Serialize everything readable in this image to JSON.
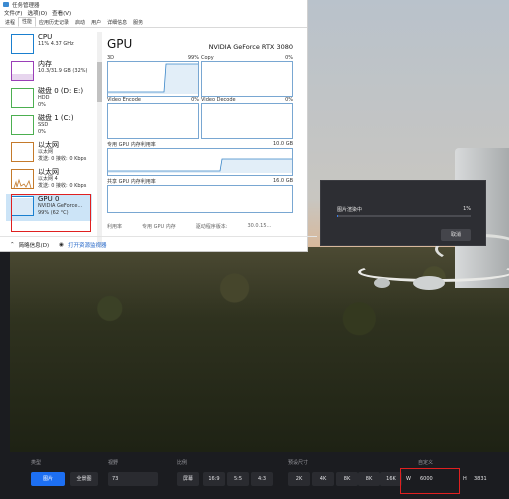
{
  "task_manager": {
    "title": "任务管理器",
    "menu": [
      "文件(F)",
      "选项(O)",
      "查看(V)"
    ],
    "tabs": [
      "进程",
      "性能",
      "应用历史记录",
      "启动",
      "用户",
      "详细信息",
      "服务"
    ],
    "active_tab": "性能",
    "resources": [
      {
        "name": "CPU",
        "sub1": "11% 4.37 GHz",
        "sub2": "",
        "color": "#1a7fcf"
      },
      {
        "name": "内存",
        "sub1": "10.3/31.9 GB (32%)",
        "sub2": "",
        "color": "#9a3fb8"
      },
      {
        "name": "磁盘 0 (D: E:)",
        "sub1": "HDD",
        "sub2": "0%",
        "color": "#4caf50"
      },
      {
        "name": "磁盘 1 (C:)",
        "sub1": "SSD",
        "sub2": "0%",
        "color": "#4caf50"
      },
      {
        "name": "以太网",
        "sub1": "以太网",
        "sub2": "发送: 0 接收: 0 Kbps",
        "color": "#c47a2b"
      },
      {
        "name": "以太网",
        "sub1": "以太网 4",
        "sub2": "发送: 0 接收: 0 Kbps",
        "color": "#c47a2b"
      },
      {
        "name": "GPU 0",
        "sub1": "NVIDIA GeForce...",
        "sub2": "99% (62 °C)",
        "color": "#1a7fcf"
      }
    ],
    "gpu_title": "GPU",
    "gpu_model": "NVIDIA GeForce RTX 3080",
    "engines": [
      {
        "name": "3D",
        "pct": "99%"
      },
      {
        "name": "Copy",
        "pct": "0%"
      },
      {
        "name": "Video Encode",
        "pct": "0%"
      },
      {
        "name": "Video Decode",
        "pct": "0%"
      }
    ],
    "dedicated_mem_label": "专用 GPU 内存利用率",
    "dedicated_mem_max": "10.0 GB",
    "shared_mem_label": "共享 GPU 内存利用率",
    "shared_mem_max": "16.0 GB",
    "stats": [
      "利用率",
      "专用 GPU 内存",
      "驱动程序版本:",
      "30.0.15..."
    ],
    "footer_brief": "简略信息(D)",
    "footer_link": "打开资源监视器"
  },
  "render_dialog": {
    "title": "图片渲染中",
    "percent": "1%",
    "progress": 0.01,
    "cancel": "取消"
  },
  "bottom_bar": {
    "type_label": "类型",
    "type_options": [
      "图片",
      "全景图"
    ],
    "type_active": "图片",
    "fov_label": "视野",
    "fov_value": "73",
    "ratio_label": "比例",
    "ratio_options": [
      "屏幕",
      "16:9",
      "5:5",
      "4:3"
    ],
    "ratio_active": "屏幕",
    "preset_label": "预设尺寸",
    "preset_options": [
      "2K",
      "4K",
      "8K",
      "8K",
      "16K"
    ],
    "custom_label": "自定义",
    "w_label": "W",
    "w_value": "6000",
    "h_label": "H",
    "h_value": "3831"
  },
  "colors": {
    "accent": "#1d6ff2",
    "highlight_red": "#e02020",
    "gpu_graph": "#79a7d2"
  }
}
